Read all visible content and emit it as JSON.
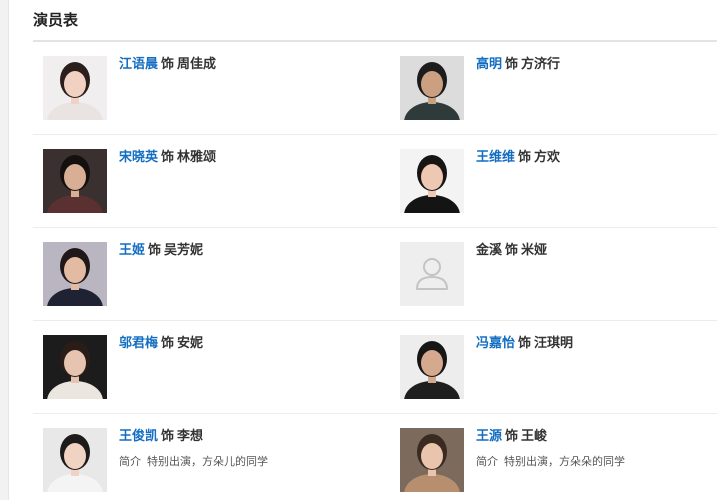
{
  "section": {
    "title": "演员表"
  },
  "cast": [
    {
      "actor": "江语晨",
      "sep": "饰",
      "role": "周佳成",
      "linked": true,
      "intro_label": "",
      "intro": "",
      "photo": {
        "bg": "#f0eeee",
        "skin": "#f1d2c2",
        "hair": "#2a1f1c",
        "cloth": "#e9e4e2"
      }
    },
    {
      "actor": "高明",
      "sep": "饰",
      "role": "方济行",
      "linked": true,
      "intro_label": "",
      "intro": "",
      "photo": {
        "bg": "#dcdcdc",
        "skin": "#caa081",
        "hair": "#1c1c1c",
        "cloth": "#2f3a3a"
      }
    },
    {
      "actor": "宋晓英",
      "sep": "饰",
      "role": "林雅颂",
      "linked": true,
      "intro_label": "",
      "intro": "",
      "photo": {
        "bg": "#3a3030",
        "skin": "#d8ae94",
        "hair": "#141010",
        "cloth": "#5a3030"
      }
    },
    {
      "actor": "王维维",
      "sep": "饰",
      "role": "方欢",
      "linked": true,
      "intro_label": "",
      "intro": "",
      "photo": {
        "bg": "#f3f3f3",
        "skin": "#efc8b4",
        "hair": "#181414",
        "cloth": "#141414"
      }
    },
    {
      "actor": "王姬",
      "sep": "饰",
      "role": "吴芳妮",
      "linked": true,
      "intro_label": "",
      "intro": "",
      "photo": {
        "bg": "#b9b6c2",
        "skin": "#e3bba3",
        "hair": "#201818",
        "cloth": "#1e2233"
      }
    },
    {
      "actor": "金溪",
      "sep": "饰",
      "role": "米娅",
      "linked": false,
      "intro_label": "",
      "intro": "",
      "photo": {
        "bg": "#eeeeee",
        "placeholder": true,
        "skin": "#cfcfcf",
        "hair": "#cfcfcf",
        "cloth": "#cfcfcf"
      }
    },
    {
      "actor": "邬君梅",
      "sep": "饰",
      "role": "安妮",
      "linked": true,
      "intro_label": "",
      "intro": "",
      "photo": {
        "bg": "#1c1c1c",
        "skin": "#e6c4b0",
        "hair": "#2a1d18",
        "cloth": "#ece6e1"
      }
    },
    {
      "actor": "冯嘉怡",
      "sep": "饰",
      "role": "汪琪明",
      "linked": true,
      "intro_label": "",
      "intro": "",
      "photo": {
        "bg": "#ededed",
        "skin": "#d4a98d",
        "hair": "#161616",
        "cloth": "#1f1f1f"
      }
    },
    {
      "actor": "王俊凯",
      "sep": "饰",
      "role": "李想",
      "linked": true,
      "intro_label": "简介",
      "intro": "特别出演，方朵儿的同学",
      "photo": {
        "bg": "#e8e8e8",
        "skin": "#f0d3c2",
        "hair": "#1d1a1a",
        "cloth": "#f4f4f4"
      }
    },
    {
      "actor": "王源",
      "sep": "饰",
      "role": "王峻",
      "linked": true,
      "intro_label": "简介",
      "intro": "特别出演，方朵朵的同学",
      "photo": {
        "bg": "#7c6a5c",
        "skin": "#e9c5ae",
        "hair": "#3a2a22",
        "cloth": "#b78f6e"
      }
    }
  ]
}
